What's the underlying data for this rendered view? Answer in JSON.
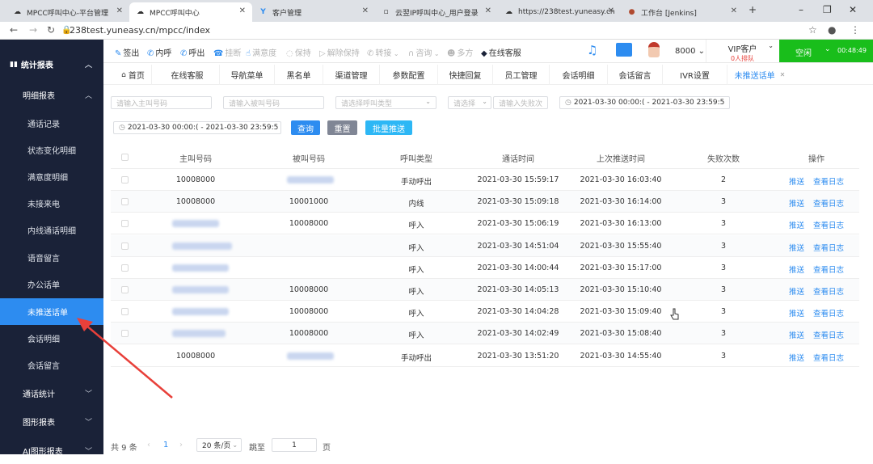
{
  "browser": {
    "tabs": [
      {
        "title": "MPCC呼叫中心-平台管理"
      },
      {
        "title": "MPCC呼叫中心"
      },
      {
        "title": "客户管理"
      },
      {
        "title": "云翌IP呼叫中心_用户登录"
      },
      {
        "title": "https://238test.yuneasy.cn"
      },
      {
        "title": "工作台 [Jenkins]"
      }
    ],
    "url": "238test.yuneasy.cn/mpcc/index"
  },
  "sidebar": {
    "items": [
      {
        "label": "统计报表"
      },
      {
        "label": "明细报表"
      },
      {
        "label": "通话记录"
      },
      {
        "label": "状态变化明细"
      },
      {
        "label": "满意度明细"
      },
      {
        "label": "未接来电"
      },
      {
        "label": "内线通话明细"
      },
      {
        "label": "语音留言"
      },
      {
        "label": "办公话单"
      },
      {
        "label": "未推送话单"
      },
      {
        "label": "会话明细"
      },
      {
        "label": "会话留言"
      },
      {
        "label": "通话统计"
      },
      {
        "label": "图形报表"
      },
      {
        "label": "AI图形报表"
      }
    ]
  },
  "toolbar": {
    "items": [
      "签出",
      "内呼",
      "呼出",
      "挂断",
      "满意度",
      "保持",
      "解除保持",
      "转接",
      "咨询",
      "多方",
      "在线客服"
    ],
    "ext": "8000",
    "vip_title": "VIP客户",
    "vip_queue": "0人排队",
    "status": "空闲",
    "timer": "00:48:49"
  },
  "page_tabs": [
    "首页",
    "在线客服",
    "导航菜单",
    "黑名单",
    "渠道管理",
    "参数配置",
    "快捷回复",
    "员工管理",
    "会话明细",
    "会话留言",
    "IVR设置",
    "未推送话单"
  ],
  "filters": {
    "caller_placeholder": "请输入主叫号码",
    "callee_placeholder": "请输入被叫号码",
    "type_placeholder": "请选择呼叫类型",
    "op_placeholder": "请选择",
    "fail_placeholder": "请输入失败次",
    "range1": "2021-03-30 00:00:( - 2021-03-30 23:59:5",
    "range2": "2021-03-30 00:00:( - 2021-03-30 23:59:5",
    "query": "查询",
    "reset": "重置",
    "batch_push": "批量推送"
  },
  "table": {
    "headers": [
      "主叫号码",
      "被叫号码",
      "呼叫类型",
      "通话时间",
      "上次推送时间",
      "失败次数",
      "操作"
    ],
    "rows": [
      {
        "caller": "10008000",
        "callee": "",
        "type": "手动呼出",
        "talk_time": "2021-03-30 15:59:17",
        "push_time": "2021-03-30 16:03:40",
        "fails": "2"
      },
      {
        "caller": "10008000",
        "callee": "10001000",
        "type": "内线",
        "talk_time": "2021-03-30 15:09:18",
        "push_time": "2021-03-30 16:14:00",
        "fails": "3"
      },
      {
        "caller": "",
        "callee": "10008000",
        "type": "呼入",
        "talk_time": "2021-03-30 15:06:19",
        "push_time": "2021-03-30 16:13:00",
        "fails": "3"
      },
      {
        "caller": "",
        "callee": "",
        "type": "呼入",
        "talk_time": "2021-03-30 14:51:04",
        "push_time": "2021-03-30 15:55:40",
        "fails": "3"
      },
      {
        "caller": "",
        "callee": "",
        "type": "呼入",
        "talk_time": "2021-03-30 14:00:44",
        "push_time": "2021-03-30 15:17:00",
        "fails": "3"
      },
      {
        "caller": "",
        "callee": "10008000",
        "type": "呼入",
        "talk_time": "2021-03-30 14:05:13",
        "push_time": "2021-03-30 15:10:40",
        "fails": "3"
      },
      {
        "caller": "",
        "callee": "10008000",
        "type": "呼入",
        "talk_time": "2021-03-30 14:04:28",
        "push_time": "2021-03-30 15:09:40",
        "fails": "3"
      },
      {
        "caller": "",
        "callee": "10008000",
        "type": "呼入",
        "talk_time": "2021-03-30 14:02:49",
        "push_time": "2021-03-30 15:08:40",
        "fails": "3"
      },
      {
        "caller": "10008000",
        "callee": "",
        "type": "手动呼出",
        "talk_time": "2021-03-30 13:51:20",
        "push_time": "2021-03-30 14:55:40",
        "fails": "3"
      }
    ],
    "op_push": "推送",
    "op_log": "查看日志"
  },
  "pagination": {
    "total": "共 9 条",
    "current_page": "1",
    "page_size": "20 条/页",
    "goto_label": "跳至",
    "goto_value": "1",
    "page_unit": "页"
  },
  "colors": {
    "accent": "#2d8cf0",
    "sidebar": "#1a2238",
    "status_green": "#19be1b",
    "arrow": "#e8403a"
  }
}
